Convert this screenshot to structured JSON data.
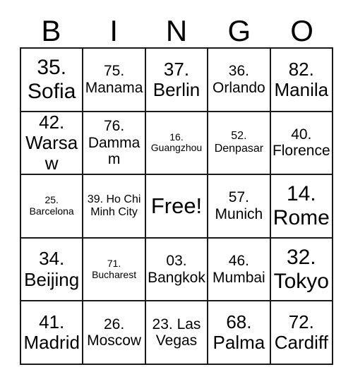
{
  "card": {
    "header": {
      "letters": [
        "B",
        "I",
        "N",
        "G",
        "O"
      ]
    },
    "free_label": "Free!",
    "rows": [
      [
        {
          "label": "35. Sofia",
          "number": "35",
          "name": "Sofia",
          "size": "xl"
        },
        {
          "label": "75. Manama",
          "number": "75",
          "name": "Manama",
          "size": "md"
        },
        {
          "label": "37. Berlin",
          "number": "37",
          "name": "Berlin",
          "size": "lg"
        },
        {
          "label": "36. Orlando",
          "number": "36",
          "name": "Orlando",
          "size": "md"
        },
        {
          "label": "82. Manila",
          "number": "82",
          "name": "Manila",
          "size": "lg"
        }
      ],
      [
        {
          "label": "42. Warsaw",
          "number": "42",
          "name": "Warsaw",
          "size": "lg"
        },
        {
          "label": "76. Dammam",
          "number": "76",
          "name": "Dammam",
          "size": "md"
        },
        {
          "label": "16. Guangzhou",
          "number": "16",
          "name": "Guangzhou",
          "size": "xs"
        },
        {
          "label": "52. Denpasar",
          "number": "52",
          "name": "Denpasar",
          "size": "sm"
        },
        {
          "label": "40. Florence",
          "number": "40",
          "name": "Florence",
          "size": "md"
        }
      ],
      [
        {
          "label": "25. Barcelona",
          "number": "25",
          "name": "Barcelona",
          "size": "xs"
        },
        {
          "label": "39. Ho Chi Minh City",
          "number": "39",
          "name": "Ho Chi Minh City",
          "size": "sm"
        },
        {
          "label": "Free!",
          "number": "",
          "name": "Free!",
          "size": "free",
          "free": true
        },
        {
          "label": "57. Munich",
          "number": "57",
          "name": "Munich",
          "size": "md"
        },
        {
          "label": "14. Rome",
          "number": "14",
          "name": "Rome",
          "size": "xl"
        }
      ],
      [
        {
          "label": "34. Beijing",
          "number": "34",
          "name": "Beijing",
          "size": "lg"
        },
        {
          "label": "71. Bucharest",
          "number": "71",
          "name": "Bucharest",
          "size": "xs"
        },
        {
          "label": "03. Bangkok",
          "number": "03",
          "name": "Bangkok",
          "size": "md"
        },
        {
          "label": "46. Mumbai",
          "number": "46",
          "name": "Mumbai",
          "size": "md"
        },
        {
          "label": "32. Tokyo",
          "number": "32",
          "name": "Tokyo",
          "size": "xl"
        }
      ],
      [
        {
          "label": "41. Madrid",
          "number": "41",
          "name": "Madrid",
          "size": "lg"
        },
        {
          "label": "26. Moscow",
          "number": "26",
          "name": "Moscow",
          "size": "md"
        },
        {
          "label": "23. Las Vegas",
          "number": "23",
          "name": "Las Vegas",
          "size": "md"
        },
        {
          "label": "68. Palma",
          "number": "68",
          "name": "Palma",
          "size": "lg"
        },
        {
          "label": "72. Cardiff",
          "number": "72",
          "name": "Cardiff",
          "size": "lg"
        }
      ]
    ],
    "colors": {
      "border": "#1a1a1a",
      "text": "#000000",
      "background": "#ffffff"
    }
  }
}
